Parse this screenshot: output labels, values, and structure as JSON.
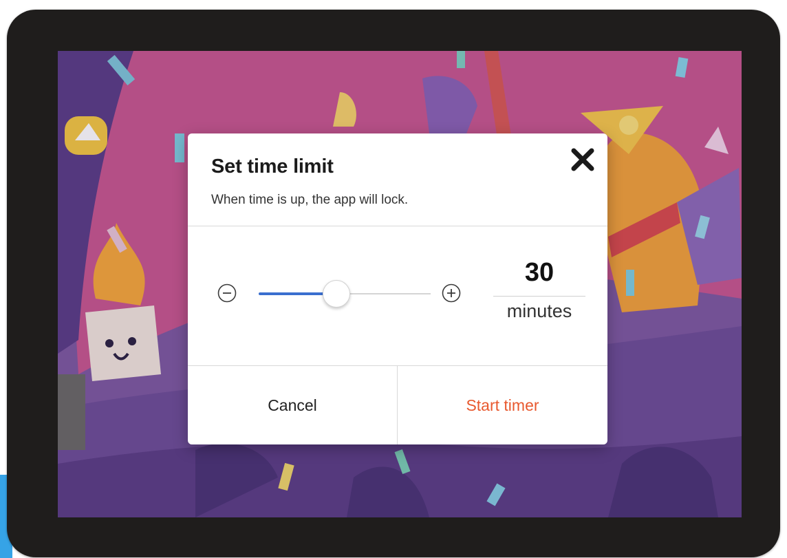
{
  "dialog": {
    "title": "Set time limit",
    "subtitle": "When time is up, the app will lock.",
    "close_icon": "close-icon",
    "stepper": {
      "decrease_icon": "minus-circle-icon",
      "increase_icon": "plus-circle-icon"
    },
    "slider": {
      "level": 0.45
    },
    "minutes": {
      "value": "30",
      "unit": "minutes"
    },
    "buttons": {
      "cancel_label": "Cancel",
      "start_label": "Start timer"
    }
  },
  "colors": {
    "accent": "#3a6fcf",
    "start_button_text": "#e8592f",
    "backdrop_pink": "#c8588f",
    "backdrop_purple": "#7e5aa0",
    "frame": "#1f1d1c"
  }
}
